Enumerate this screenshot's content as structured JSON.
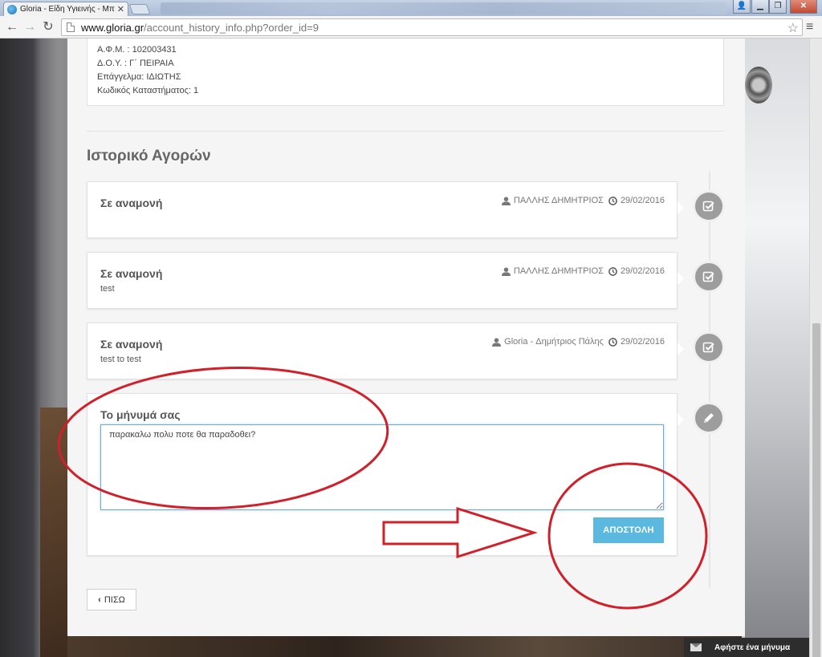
{
  "browser": {
    "tab_title": "Gloria - Είδη Υγιεινής - Μπ",
    "url_host": "www.gloria.gr",
    "url_path": "/account_history_info.php?order_id=9"
  },
  "account_info": {
    "lines": [
      "Α.Φ.Μ. : 102003431",
      "Δ.Ο.Υ. : Γ΄ ΠΕΙΡΑΙΑ",
      "Επάγγελμα: ΙΔΙΩΤΗΣ",
      "Κωδικός Καταστήματος: 1"
    ]
  },
  "history": {
    "title": "Ιστορικό Αγορών",
    "entries": [
      {
        "status": "Σε αναμονή",
        "note": "",
        "user": "ΠΑΛΛΗΣ ΔΗΜΗΤΡΙΟΣ",
        "date": "29/02/2016"
      },
      {
        "status": "Σε αναμονή",
        "note": "test",
        "user": "ΠΑΛΛΗΣ ΔΗΜΗΤΡΙΟΣ",
        "date": "29/02/2016"
      },
      {
        "status": "Σε αναμονή",
        "note": "test to test",
        "user": "Gloria - Δημήτριος Πάλης",
        "date": "29/02/2016"
      }
    ]
  },
  "message_form": {
    "label": "Το μήνυμά σας",
    "value": "παρακαλω πολυ ποτε θα παραδοθει?",
    "submit_label": "ΑΠΟΣΤΟΛΗ"
  },
  "back_button": {
    "label": "ΠΙΣΩ"
  },
  "chat_widget": {
    "label": "Αφήστε ένα μήνυμα"
  },
  "colors": {
    "submit_button": "#5bb8de",
    "timeline_badge": "#9d9d9d",
    "annotation": "#d0202a"
  },
  "icons": {
    "history_badge": "check-square-icon",
    "compose_badge": "pencil-icon",
    "author": "user-icon",
    "date": "clock-icon"
  }
}
